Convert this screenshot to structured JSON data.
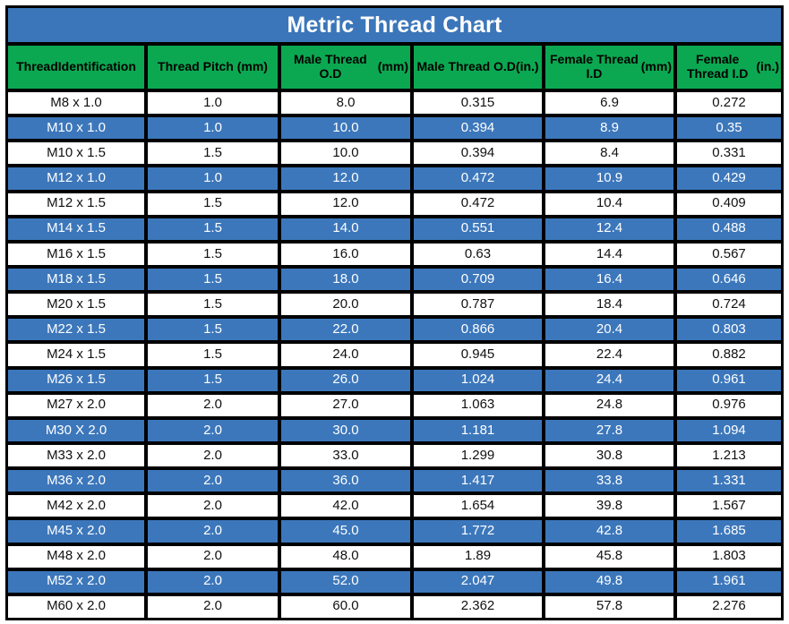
{
  "title": "Metric Thread Chart",
  "colors": {
    "title_bar": "#3b76ba",
    "header": "#0ba851",
    "row_alt": "#3c77bb",
    "row_base": "#ffffff",
    "grid_line": "#000000"
  },
  "table": {
    "columns": [
      "Thread Identification",
      "Thread Pitch (mm)",
      "Male Thread O.D (mm)",
      "Male Thread O.D (in.)",
      "Female Thread I.D (mm)",
      "Female Thread I.D (in.)"
    ],
    "column_lines": [
      [
        "Thread",
        "Identification"
      ],
      [
        "Thread Pitch (mm)",
        ""
      ],
      [
        "Male Thread O.D",
        "(mm)"
      ],
      [
        "Male Thread O.D",
        "(in.)"
      ],
      [
        "Female Thread I.D",
        "(mm)"
      ],
      [
        "Female Thread I.D",
        "(in.)"
      ]
    ],
    "rows": [
      [
        "M8 x 1.0",
        "1.0",
        "8.0",
        "0.315",
        "6.9",
        "0.272"
      ],
      [
        "M10 x 1.0",
        "1.0",
        "10.0",
        "0.394",
        "8.9",
        "0.35"
      ],
      [
        "M10 x 1.5",
        "1.5",
        "10.0",
        "0.394",
        "8.4",
        "0.331"
      ],
      [
        "M12 x 1.0",
        "1.0",
        "12.0",
        "0.472",
        "10.9",
        "0.429"
      ],
      [
        "M12 x 1.5",
        "1.5",
        "12.0",
        "0.472",
        "10.4",
        "0.409"
      ],
      [
        "M14 x 1.5",
        "1.5",
        "14.0",
        "0.551",
        "12.4",
        "0.488"
      ],
      [
        "M16 x 1.5",
        "1.5",
        "16.0",
        "0.63",
        "14.4",
        "0.567"
      ],
      [
        "M18 x 1.5",
        "1.5",
        "18.0",
        "0.709",
        "16.4",
        "0.646"
      ],
      [
        "M20 x 1.5",
        "1.5",
        "20.0",
        "0.787",
        "18.4",
        "0.724"
      ],
      [
        "M22 x 1.5",
        "1.5",
        "22.0",
        "0.866",
        "20.4",
        "0.803"
      ],
      [
        "M24 x 1.5",
        "1.5",
        "24.0",
        "0.945",
        "22.4",
        "0.882"
      ],
      [
        "M26 x 1.5",
        "1.5",
        "26.0",
        "1.024",
        "24.4",
        "0.961"
      ],
      [
        "M27 x 2.0",
        "2.0",
        "27.0",
        "1.063",
        "24.8",
        "0.976"
      ],
      [
        "M30 X 2.0",
        "2.0",
        "30.0",
        "1.181",
        "27.8",
        "1.094"
      ],
      [
        "M33 x 2.0",
        "2.0",
        "33.0",
        "1.299",
        "30.8",
        "1.213"
      ],
      [
        "M36 x 2.0",
        "2.0",
        "36.0",
        "1.417",
        "33.8",
        "1.331"
      ],
      [
        "M42 x 2.0",
        "2.0",
        "42.0",
        "1.654",
        "39.8",
        "1.567"
      ],
      [
        "M45 x 2.0",
        "2.0",
        "45.0",
        "1.772",
        "42.8",
        "1.685"
      ],
      [
        "M48 x 2.0",
        "2.0",
        "48.0",
        "1.89",
        "45.8",
        "1.803"
      ],
      [
        "M52 x 2.0",
        "2.0",
        "52.0",
        "2.047",
        "49.8",
        "1.961"
      ],
      [
        "M60 x 2.0",
        "2.0",
        "60.0",
        "2.362",
        "57.8",
        "2.276"
      ]
    ]
  },
  "chart_data": {
    "type": "table",
    "title": "Metric Thread Chart",
    "columns": [
      "Thread Identification",
      "Thread Pitch (mm)",
      "Male Thread O.D (mm)",
      "Male Thread O.D (in.)",
      "Female Thread I.D (mm)",
      "Female Thread I.D (in.)"
    ],
    "rows": [
      [
        "M8 x 1.0",
        "1.0",
        "8.0",
        "0.315",
        "6.9",
        "0.272"
      ],
      [
        "M10 x 1.0",
        "1.0",
        "10.0",
        "0.394",
        "8.9",
        "0.35"
      ],
      [
        "M10 x 1.5",
        "1.5",
        "10.0",
        "0.394",
        "8.4",
        "0.331"
      ],
      [
        "M12 x 1.0",
        "1.0",
        "12.0",
        "0.472",
        "10.9",
        "0.429"
      ],
      [
        "M12 x 1.5",
        "1.5",
        "12.0",
        "0.472",
        "10.4",
        "0.409"
      ],
      [
        "M14 x 1.5",
        "1.5",
        "14.0",
        "0.551",
        "12.4",
        "0.488"
      ],
      [
        "M16 x 1.5",
        "1.5",
        "16.0",
        "0.63",
        "14.4",
        "0.567"
      ],
      [
        "M18 x 1.5",
        "1.5",
        "18.0",
        "0.709",
        "16.4",
        "0.646"
      ],
      [
        "M20 x 1.5",
        "1.5",
        "20.0",
        "0.787",
        "18.4",
        "0.724"
      ],
      [
        "M22 x 1.5",
        "1.5",
        "22.0",
        "0.866",
        "20.4",
        "0.803"
      ],
      [
        "M24 x 1.5",
        "1.5",
        "24.0",
        "0.945",
        "22.4",
        "0.882"
      ],
      [
        "M26 x 1.5",
        "1.5",
        "26.0",
        "1.024",
        "24.4",
        "0.961"
      ],
      [
        "M27 x 2.0",
        "2.0",
        "27.0",
        "1.063",
        "24.8",
        "0.976"
      ],
      [
        "M30 X 2.0",
        "2.0",
        "30.0",
        "1.181",
        "27.8",
        "1.094"
      ],
      [
        "M33 x 2.0",
        "2.0",
        "33.0",
        "1.299",
        "30.8",
        "1.213"
      ],
      [
        "M36 x 2.0",
        "2.0",
        "36.0",
        "1.417",
        "33.8",
        "1.331"
      ],
      [
        "M42 x 2.0",
        "2.0",
        "42.0",
        "1.654",
        "39.8",
        "1.567"
      ],
      [
        "M45 x 2.0",
        "2.0",
        "45.0",
        "1.772",
        "42.8",
        "1.685"
      ],
      [
        "M48 x 2.0",
        "2.0",
        "48.0",
        "1.89",
        "45.8",
        "1.803"
      ],
      [
        "M52 x 2.0",
        "2.0",
        "52.0",
        "2.047",
        "49.8",
        "1.961"
      ],
      [
        "M60 x 2.0",
        "2.0",
        "60.0",
        "2.362",
        "57.8",
        "2.276"
      ]
    ]
  }
}
